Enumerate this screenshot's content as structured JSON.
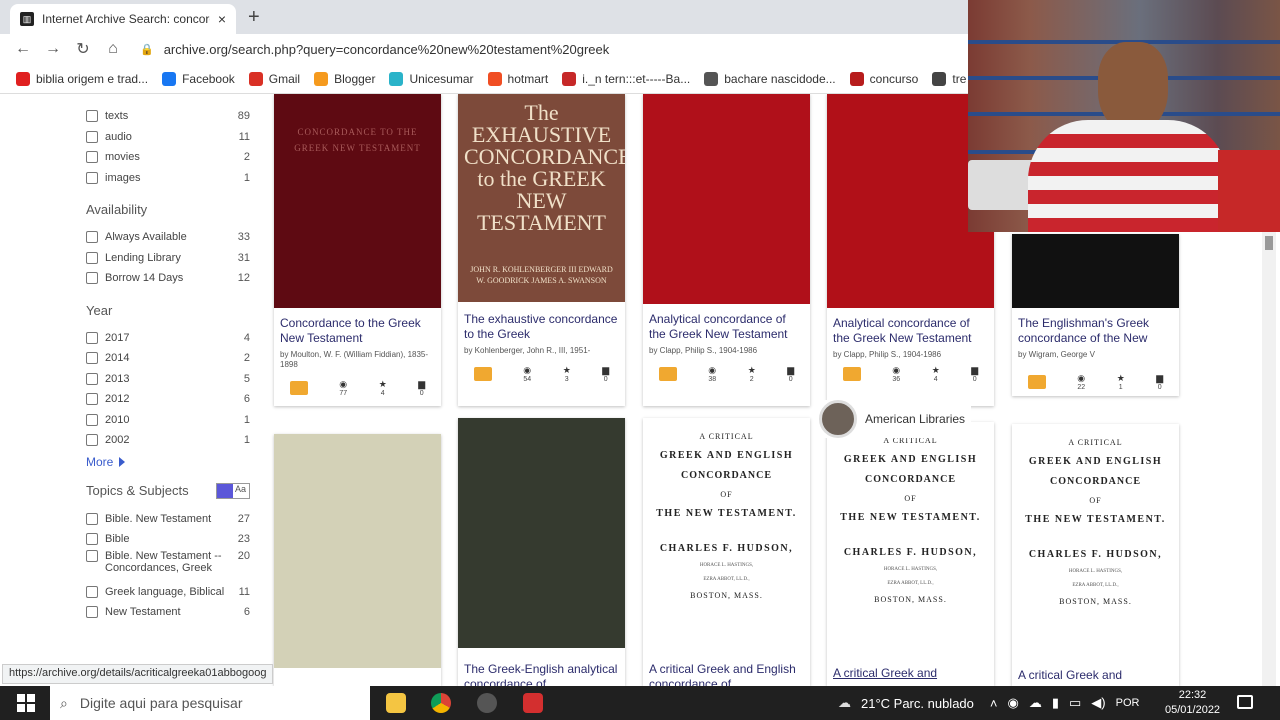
{
  "browser": {
    "tab_title": "Internet Archive Search: concord",
    "new_tab": "+",
    "close": "×",
    "url": "archive.org/search.php?query=concordance%20new%20testament%20greek"
  },
  "bookmarks": [
    {
      "label": "biblia origem e trad...",
      "icon": "youtube-icon",
      "color": "#e02020"
    },
    {
      "label": "Facebook",
      "icon": "facebook-icon",
      "color": "#1877f2"
    },
    {
      "label": "Gmail",
      "icon": "gmail-icon",
      "color": "#d93025"
    },
    {
      "label": "Blogger",
      "icon": "blogger-icon",
      "color": "#f59a1e"
    },
    {
      "label": "Unicesumar",
      "icon": "unicesumar-icon",
      "color": "#2ab3c9"
    },
    {
      "label": "hotmart",
      "icon": "hotmart-icon",
      "color": "#f04e23"
    },
    {
      "label": "i._n tern:::et-----Ba...",
      "icon": "x-icon",
      "color": "#c62828"
    },
    {
      "label": "bachare nascidode...",
      "icon": "chat-icon",
      "color": "#555555"
    },
    {
      "label": "concurso",
      "icon": "concurso-icon",
      "color": "#b71c1c"
    },
    {
      "label": "tre",
      "icon": "globe-icon",
      "color": "#444444"
    }
  ],
  "sidebar": {
    "mediatype": [
      {
        "label": "texts",
        "count": "89"
      },
      {
        "label": "audio",
        "count": "11"
      },
      {
        "label": "movies",
        "count": "2"
      },
      {
        "label": "images",
        "count": "1"
      }
    ],
    "availability_title": "Availability",
    "availability": [
      {
        "label": "Always Available",
        "count": "33"
      },
      {
        "label": "Lending Library",
        "count": "31"
      },
      {
        "label": "Borrow 14 Days",
        "count": "12"
      }
    ],
    "year_title": "Year",
    "years": [
      {
        "label": "2017",
        "count": "4"
      },
      {
        "label": "2014",
        "count": "2"
      },
      {
        "label": "2013",
        "count": "5"
      },
      {
        "label": "2012",
        "count": "6"
      },
      {
        "label": "2010",
        "count": "1"
      },
      {
        "label": "2002",
        "count": "1"
      }
    ],
    "more": "More",
    "topics_title": "Topics & Subjects",
    "topics_toggle": "Aa",
    "topics": [
      {
        "label": "Bible. New Testament",
        "count": "27"
      },
      {
        "label": "Bible",
        "count": "23"
      },
      {
        "label": "Bible. New Testament -- Concordances, Greek",
        "count": "20"
      },
      {
        "label": "Greek language, Biblical",
        "count": "11"
      },
      {
        "label": "New Testament",
        "count": "6"
      }
    ]
  },
  "results_row1": [
    {
      "title": "Concordance to the Greek New Testament",
      "author": "by Moulton, W. F. (William Fiddian), 1835-1898",
      "views": "77",
      "favs": "4",
      "reviews": "0",
      "cover_text": "CONCORDANCE TO THE GREEK NEW TESTAMENT"
    },
    {
      "title": "The exhaustive concordance to the Greek",
      "author": "by Kohlenberger, John R., III, 1951-",
      "views": "54",
      "favs": "3",
      "reviews": "0",
      "cover_text": "The EXHAUSTIVE CONCORDANCE to the GREEK NEW TESTAMENT",
      "cover_sub": "JOHN R. KOHLENBERGER III EDWARD W. GOODRICK JAMES A. SWANSON"
    },
    {
      "title": "Analytical concordance of the Greek New Testament",
      "author": "by Clapp, Philip S., 1904-1986",
      "views": "38",
      "favs": "2",
      "reviews": "0"
    },
    {
      "title": "Analytical concordance of the Greek New Testament",
      "author": "by Clapp, Philip S., 1904-1986",
      "views": "36",
      "favs": "4",
      "reviews": "0"
    },
    {
      "title": "The Englishman's Greek concordance of the New",
      "author": "by Wigram, George V",
      "views": "22",
      "favs": "1",
      "reviews": "0"
    }
  ],
  "results_row2": [
    {
      "title": ""
    },
    {
      "title": "The Greek-English analytical concordance of"
    },
    {
      "title": "A critical Greek and English concordance of"
    },
    {
      "title": "A critical Greek and",
      "collection": "American Libraries"
    },
    {
      "title": "A critical Greek and"
    }
  ],
  "print_cover": {
    "l1": "A CRITICAL",
    "l2": "GREEK AND ENGLISH",
    "l3": "CONCORDANCE",
    "l4": "OF",
    "l5": "THE NEW TESTAMENT.",
    "l6": "CHARLES F. HUDSON,",
    "l7": "HORACE L. HASTINGS,",
    "l8": "EZRA ABBOT, LL.D.,",
    "l9": "BOSTON, MASS."
  },
  "status_url": "https://archive.org/details/acriticalgreeka01abbogoog",
  "taskbar": {
    "search_placeholder": "Digite aqui para pesquisar",
    "weather": "21°C  Parc. nublado",
    "lang": "POR",
    "time": "22:32",
    "date": "05/01/2022"
  }
}
